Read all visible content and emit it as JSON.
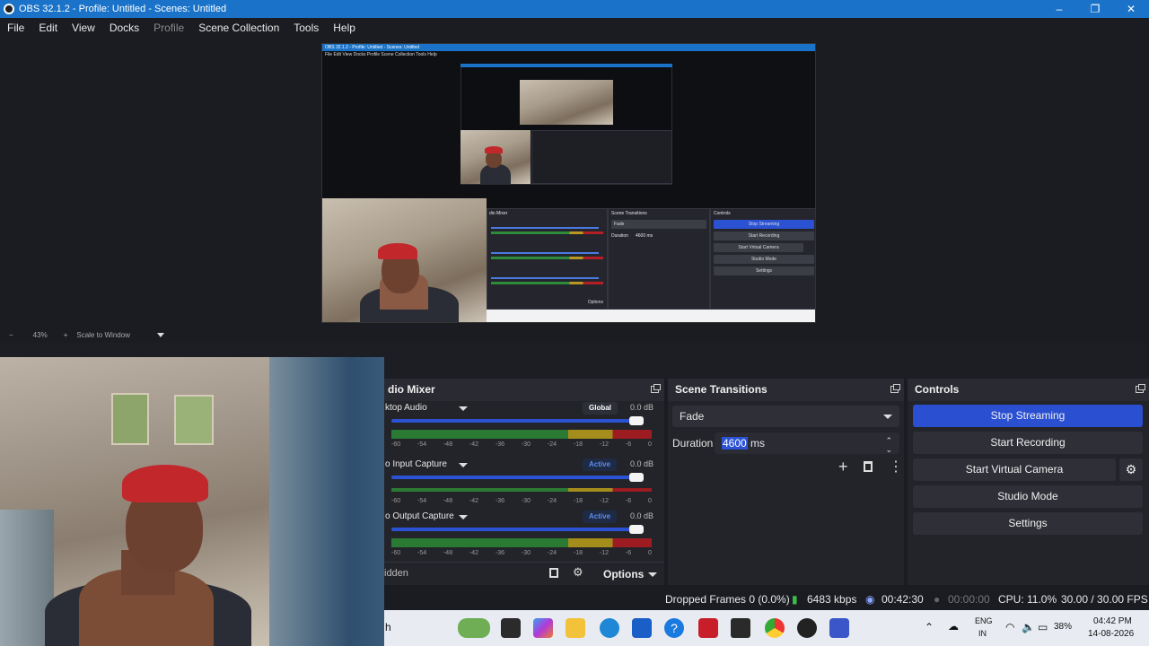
{
  "window": {
    "title": "OBS 32.1.2 - Profile: Untitled - Scenes: Untitled"
  },
  "menu": [
    "File",
    "Edit",
    "View",
    "Docks",
    "Profile",
    "Scene Collection",
    "Tools",
    "Help"
  ],
  "zoom": {
    "minus": "−",
    "value": "43%",
    "plus": "+",
    "mode": "Scale to Window"
  },
  "mixer": {
    "title": "dio Mixer",
    "channels": [
      {
        "name": "ktop Audio",
        "badge": "Global",
        "db": "0.0 dB",
        "level": 0.97
      },
      {
        "name": "o Input Capture",
        "badge": "Active",
        "db": "0.0 dB",
        "level": 0.97
      },
      {
        "name": "o Output Capture",
        "badge": "Active",
        "db": "0.0 dB",
        "level": 0.97
      }
    ],
    "ticks": [
      "-60",
      "-54",
      "-48",
      "-42",
      "-36",
      "-30",
      "-24",
      "-18",
      "-12",
      "-6",
      "0"
    ],
    "hidden_label": "idden",
    "options_label": "Options"
  },
  "transitions": {
    "title": "Scene Transitions",
    "selected": "Fade",
    "duration_label": "Duration",
    "duration_value": "4600",
    "duration_unit": "ms"
  },
  "controls": {
    "title": "Controls",
    "stop_streaming": "Stop Streaming",
    "start_recording": "Start Recording",
    "start_virtual_camera": "Start Virtual Camera",
    "studio_mode": "Studio Mode",
    "settings": "Settings"
  },
  "status": {
    "dropped_frames": "Dropped Frames 0 (0.0%)",
    "bitrate": "6483 kbps",
    "stream_time": "00:42:30",
    "record_time": "00:00:00",
    "cpu": "CPU: 11.0%",
    "fps": "30.00 / 30.00 FPS"
  },
  "taskbar": {
    "search_fragment": "h",
    "lang_line1": "ENG",
    "lang_line2": "IN",
    "battery": "38%",
    "time": "04:42 PM",
    "date": "14-08-2026"
  },
  "nested": {
    "title": "OBS 32.1.2 - Profile: Untitled - Scenes: Untitled",
    "menu": "File   Edit   View   Docks   Profile   Scene Collection   Tools   Help",
    "stop_streaming": "Stop Streaming",
    "start_recording": "Start Recording",
    "start_virtual_camera": "Start Virtual Camera",
    "studio_mode": "Studio Mode",
    "settings": "Settings",
    "fade": "Fade",
    "duration": "Duration",
    "duration_value": "4600 ms",
    "mixer_title": "dio Mixer",
    "scene_transitions": "Scene Transitions",
    "controls": "Controls",
    "options": "Options"
  }
}
